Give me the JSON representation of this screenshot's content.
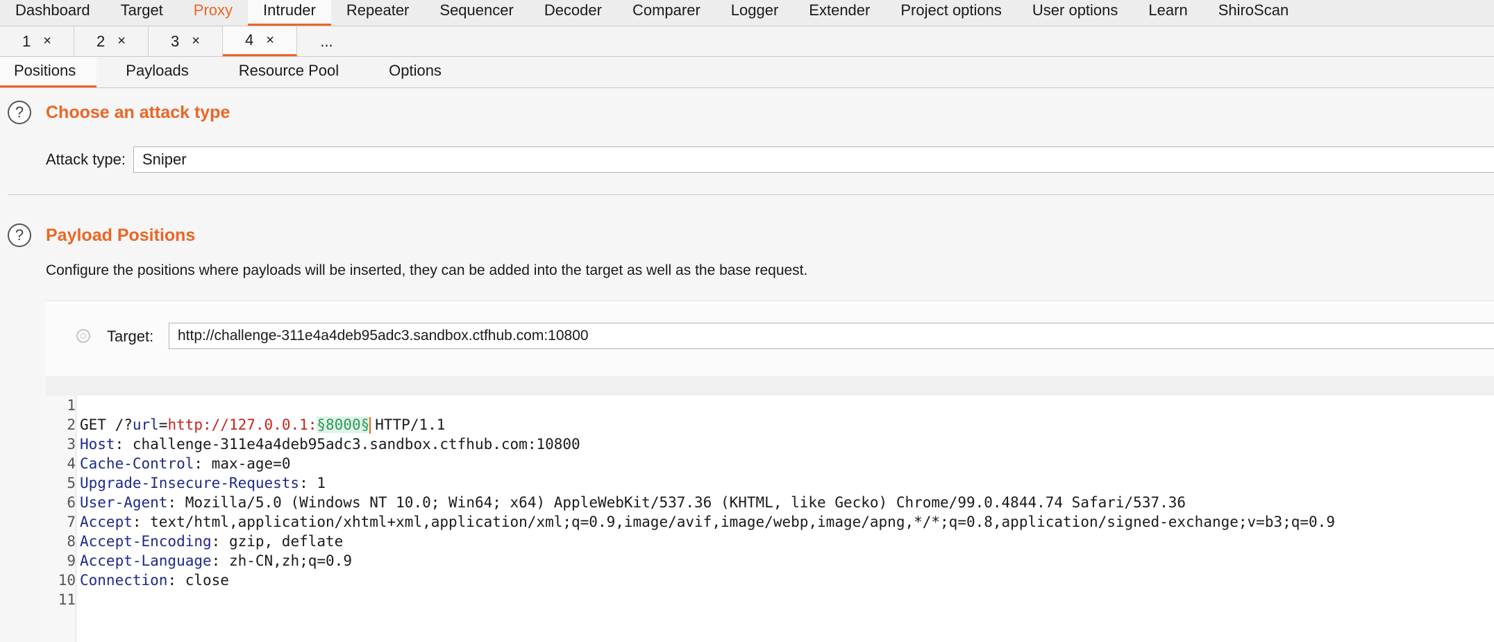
{
  "top_nav": [
    {
      "label": "Dashboard"
    },
    {
      "label": "Target"
    },
    {
      "label": "Proxy"
    },
    {
      "label": "Intruder"
    },
    {
      "label": "Repeater"
    },
    {
      "label": "Sequencer"
    },
    {
      "label": "Decoder"
    },
    {
      "label": "Comparer"
    },
    {
      "label": "Logger"
    },
    {
      "label": "Extender"
    },
    {
      "label": "Project options"
    },
    {
      "label": "User options"
    },
    {
      "label": "Learn"
    },
    {
      "label": "ShiroScan"
    }
  ],
  "attack_tabs": [
    {
      "label": "1"
    },
    {
      "label": "2"
    },
    {
      "label": "3"
    },
    {
      "label": "4"
    }
  ],
  "close_glyph": "×",
  "more_tabs": "...",
  "sub_tabs": [
    {
      "label": "Positions"
    },
    {
      "label": "Payloads"
    },
    {
      "label": "Resource Pool"
    },
    {
      "label": "Options"
    }
  ],
  "help_glyph": "?",
  "attack_section": {
    "title": "Choose an attack type",
    "label": "Attack type:",
    "value": "Sniper"
  },
  "positions_section": {
    "title": "Payload Positions",
    "description": "Configure the positions where payloads will be inserted, they can be added into the target as well as the base request.",
    "target_label": "Target:",
    "target_value": "http://challenge-311e4a4deb95adc3.sandbox.ctfhub.com:10800"
  },
  "request": {
    "line_numbers": [
      "1",
      "2",
      "3",
      "4",
      "5",
      "6",
      "7",
      "8",
      "9",
      "10",
      "11"
    ],
    "request_line": {
      "method": "GET /?",
      "param": "url",
      "eq": "=",
      "value": "http://127.0.0.1:",
      "marker": "§8000§",
      "version": "HTTP/1.1"
    },
    "headers": [
      {
        "name": "Host",
        "value": "challenge-311e4a4deb95adc3.sandbox.ctfhub.com:10800"
      },
      {
        "name": "Cache-Control",
        "value": "max-age=0"
      },
      {
        "name": "Upgrade-Insecure-Requests",
        "value": "1"
      },
      {
        "name": "User-Agent",
        "value": "Mozilla/5.0 (Windows NT 10.0; Win64; x64) AppleWebKit/537.36 (KHTML, like Gecko) Chrome/99.0.4844.74 Safari/537.36"
      },
      {
        "name": "Accept",
        "value": "text/html,application/xhtml+xml,application/xml;q=0.9,image/avif,image/webp,image/apng,*/*;q=0.8,application/signed-exchange;v=b3;q=0.9"
      },
      {
        "name": "Accept-Encoding",
        "value": "gzip, deflate"
      },
      {
        "name": "Accept-Language",
        "value": "zh-CN,zh;q=0.9"
      },
      {
        "name": "Connection",
        "value": "close"
      }
    ],
    "header_sep": ": "
  },
  "colors": {
    "accent": "#ec6525",
    "header_key": "#1c2a8a",
    "param_value": "#c6241c",
    "payload_marker": "#2b9a5c"
  }
}
